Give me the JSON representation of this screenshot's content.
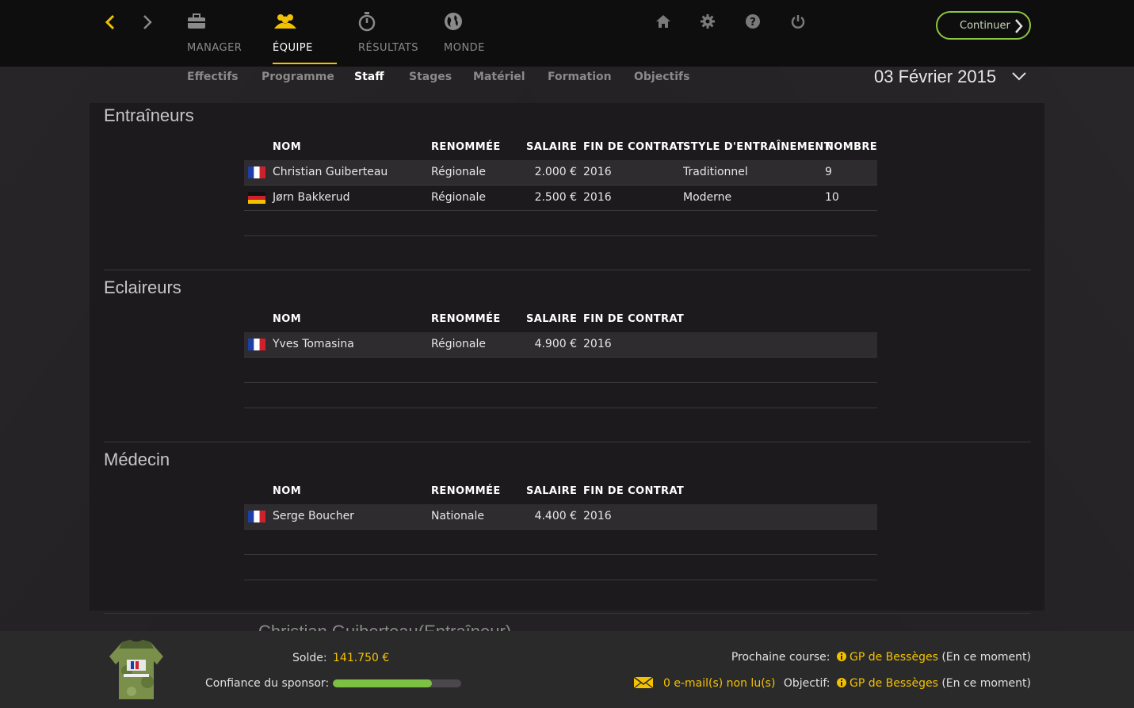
{
  "nav": {
    "tabs": [
      {
        "label": "MANAGER",
        "icon": "briefcase-icon"
      },
      {
        "label": "ÉQUIPE",
        "icon": "team-icon",
        "active": true
      },
      {
        "label": "RÉSULTATS",
        "icon": "stopwatch-icon"
      },
      {
        "label": "MONDE",
        "icon": "globe-icon"
      }
    ],
    "continue_label": "Continuer"
  },
  "subnav": {
    "tabs": [
      "Effectifs",
      "Programme",
      "Staff",
      "Stages",
      "Matériel",
      "Formation",
      "Objectifs"
    ],
    "active": "Staff",
    "date": "03 Février 2015"
  },
  "colors": {
    "accent": "#f2c200",
    "continue": "#8dc63f",
    "sponsor_bar": "#7cc142"
  },
  "sections": {
    "trainers": {
      "title": "Entraîneurs",
      "headers": [
        "NOM",
        "RENOMMÉE",
        "SALAIRE",
        "FIN DE CONTRAT",
        "STYLE D'ENTRAÎNEMENT",
        "NOMBRE"
      ],
      "rows": [
        {
          "flag": "fr",
          "name": "Christian Guiberteau",
          "renown": "Régionale",
          "salary": "2.000 €",
          "end": "2016",
          "style": "Traditionnel",
          "count": "9"
        },
        {
          "flag": "de",
          "name": "Jørn Bakkerud",
          "renown": "Régionale",
          "salary": "2.500 €",
          "end": "2016",
          "style": "Moderne",
          "count": "10"
        }
      ]
    },
    "scouts": {
      "title": "Eclaireurs",
      "headers": [
        "NOM",
        "RENOMMÉE",
        "SALAIRE",
        "FIN DE CONTRAT"
      ],
      "rows": [
        {
          "flag": "fr",
          "name": "Yves Tomasina",
          "renown": "Régionale",
          "salary": "4.900 €",
          "end": "2016"
        }
      ]
    },
    "doctor": {
      "title": "Médecin",
      "headers": [
        "NOM",
        "RENOMMÉE",
        "SALAIRE",
        "FIN DE CONTRAT"
      ],
      "rows": [
        {
          "flag": "fr",
          "name": "Serge Boucher",
          "renown": "Nationale",
          "salary": "4.400 €",
          "end": "2016"
        }
      ]
    }
  },
  "preview_title": "Christian Guiberteau(Entraîneur)",
  "footer": {
    "balance_label": "Solde:",
    "balance": "141.750 €",
    "sponsor_label": "Confiance du sponsor:",
    "sponsor_confidence": 0.77,
    "next_race_label": "Prochaine course:",
    "next_race": "GP de Bessèges",
    "next_race_status": "(En ce moment)",
    "emails": "0 e-mail(s) non lu(s)",
    "objective_label": "Objectif:",
    "objective": "GP de Bessèges",
    "objective_status": "(En ce moment)"
  }
}
